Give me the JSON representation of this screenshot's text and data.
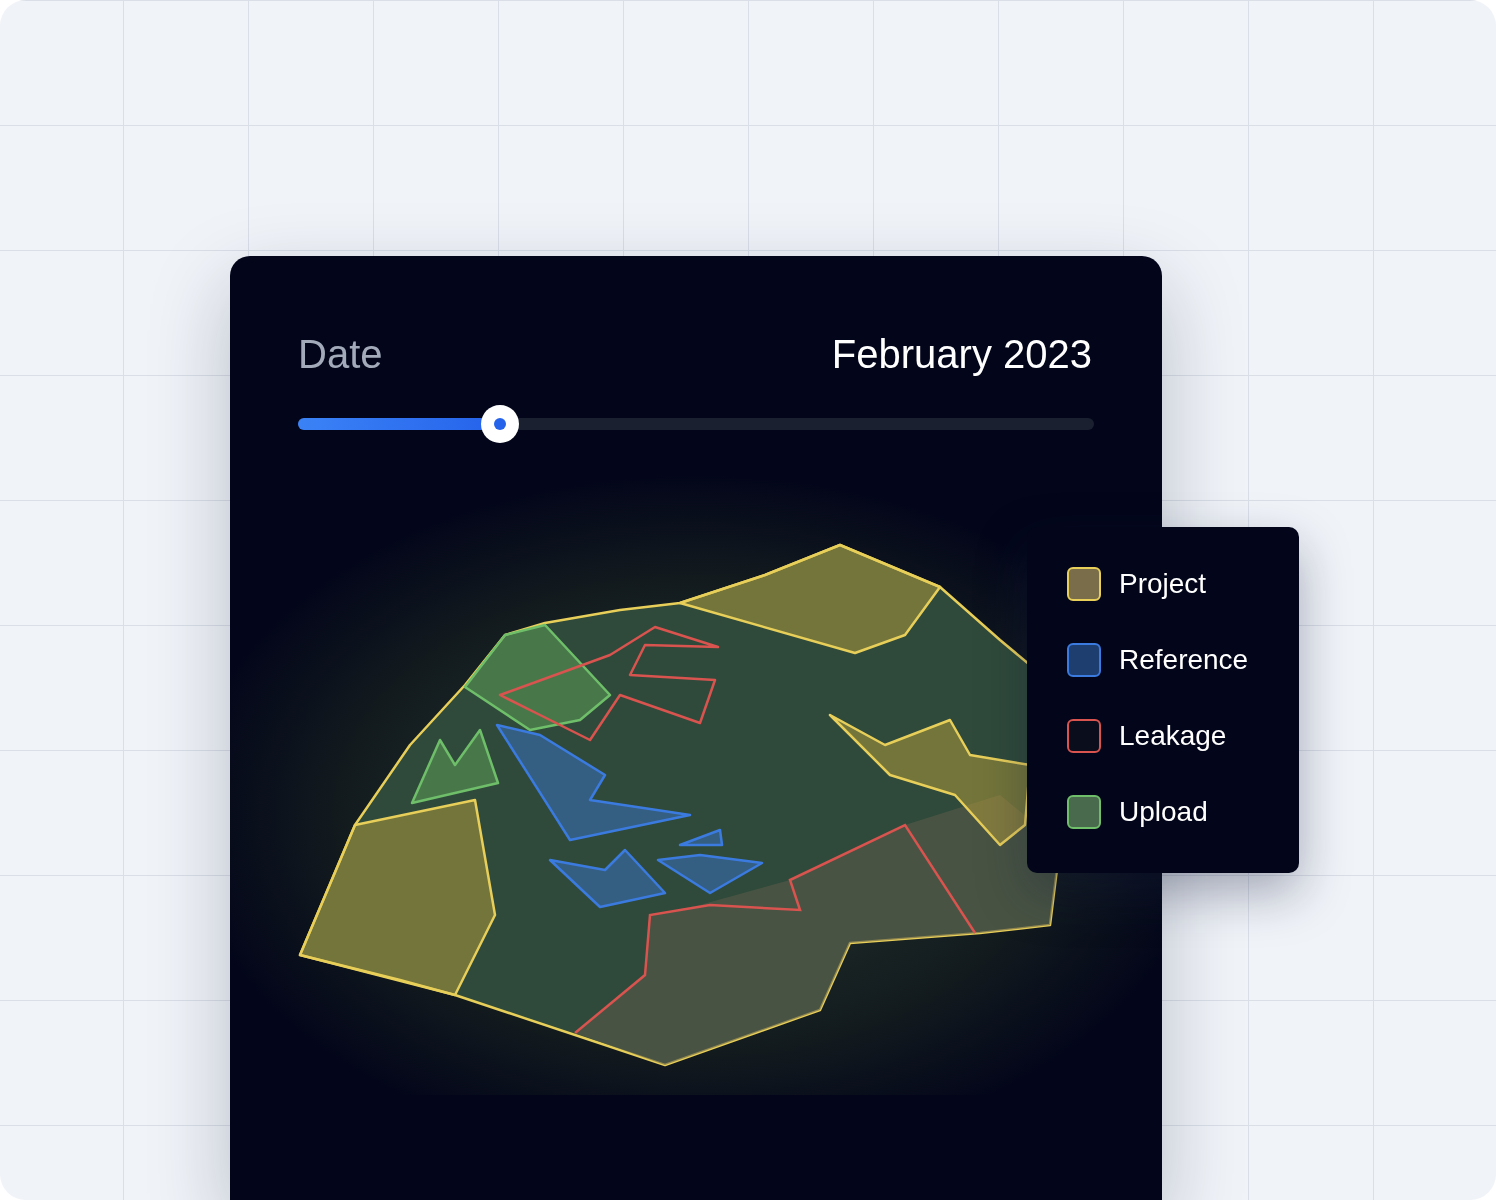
{
  "date_label": "Date",
  "date_value": "February 2023",
  "slider": {
    "level": 0.254
  },
  "legend": [
    {
      "label": "Project",
      "kind": "project",
      "color": "#7a6d4a"
    },
    {
      "label": "Reference",
      "kind": "reference",
      "color": "#1f3e70"
    },
    {
      "label": "Leakage",
      "kind": "leakage",
      "color": "#0a0d1c"
    },
    {
      "label": "Upload",
      "kind": "upload",
      "color": "#4a6a4e"
    }
  ]
}
